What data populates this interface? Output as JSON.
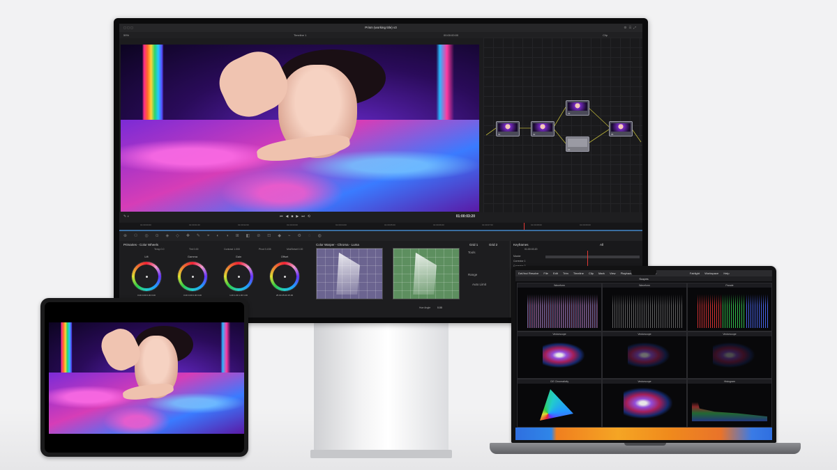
{
  "resolve": {
    "project_title": "Prism (working title) v3",
    "page_mode": "Edited",
    "timeline": "Timeline 1",
    "viewer_zoom": "59%",
    "timecode": "01:00:03:20",
    "timecode_left": "00:00:00:00",
    "clip_menu": "Clip",
    "ruler_ticks": [
      "01:00:00:00",
      "01:00:01:00",
      "01:00:02:00",
      "01:00:03:00",
      "01:00:04:00",
      "01:00:05:00",
      "01:00:06:00",
      "01:00:07:00",
      "01:00:08:00",
      "01:00:09:00",
      "01:00:10:00"
    ],
    "nodes": [
      "01",
      "02",
      "03",
      "04",
      "05"
    ],
    "primaries_label": "Primaries - Color Wheels",
    "primaries_params": [
      "Temp 0.0",
      "Tint 0.00",
      "Contrast 1.000",
      "Pivot 0.435",
      "Mid/Detail 0.00"
    ],
    "wheels": [
      {
        "label": "Lift",
        "values": "0.00  0.00  0.00  0.00"
      },
      {
        "label": "Gamma",
        "values": "0.00  0.00  0.00  0.00"
      },
      {
        "label": "Gain",
        "values": "1.00  1.00  1.00  1.00"
      },
      {
        "label": "Offset",
        "values": "25.00  25.00  25.00"
      }
    ],
    "warper_label": "Color Warper - Chroma - Luma",
    "grids": [
      "Grid 1",
      "Grid 2"
    ],
    "tools_label": "Tools",
    "range_label": "Range",
    "auto_limit": "Auto Limit",
    "hue_angle_label": "Hue Angle",
    "hue_angle_value": "0.00",
    "keyframes_label": "Keyframes",
    "keyframes_mode": "All",
    "keyframes_tc": "01:00:03:20",
    "keyframe_rows": [
      "Master",
      "Corrector 1",
      "Corrector 2",
      "Corrector 3"
    ]
  },
  "macbook": {
    "menu_items": [
      "DaVinci Resolve",
      "File",
      "Edit",
      "Trim",
      "Timeline",
      "Clip",
      "Mark",
      "View",
      "Playback",
      "Fusion",
      "Color",
      "Fairlight",
      "Workspace",
      "Help"
    ],
    "window_title": "Scopes",
    "scopes": [
      {
        "title": "Waveform"
      },
      {
        "title": "Waveform"
      },
      {
        "title": "Parade"
      },
      {
        "title": "Vectorscope"
      },
      {
        "title": "Vectorscope"
      },
      {
        "title": "Vectorscope"
      },
      {
        "title": "CIE Chromaticity"
      },
      {
        "title": "Vectorscope"
      },
      {
        "title": "Histogram"
      }
    ]
  }
}
